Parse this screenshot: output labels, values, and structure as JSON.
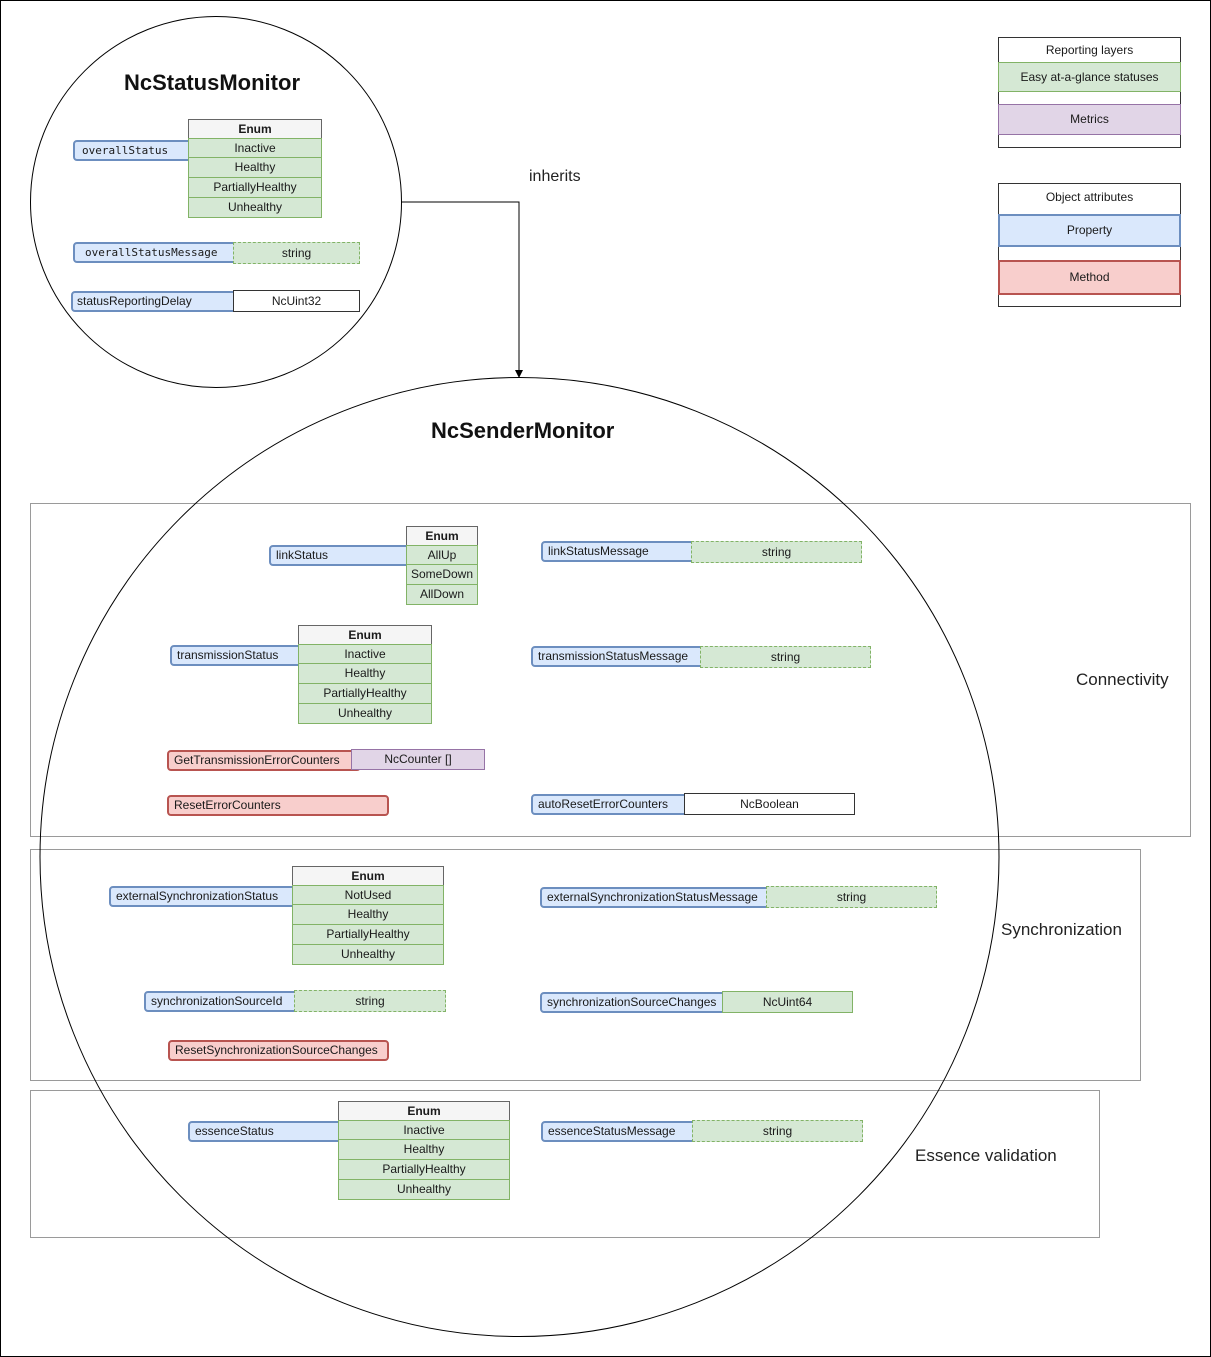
{
  "status_monitor": {
    "title": "NcStatusMonitor",
    "overall_status": {
      "name": "overallStatus",
      "enum_header": "Enum",
      "values": [
        "Inactive",
        "Healthy",
        "PartiallyHealthy",
        "Unhealthy"
      ]
    },
    "overall_status_message": {
      "name": "overallStatusMessage",
      "type": "string"
    },
    "status_reporting_delay": {
      "name": "statusReportingDelay",
      "type": "NcUint32"
    }
  },
  "inherits_label": "inherits",
  "sender_monitor": {
    "title": "NcSenderMonitor",
    "sections": {
      "connectivity": {
        "label": "Connectivity",
        "link_status": {
          "name": "linkStatus",
          "enum_header": "Enum",
          "values": [
            "AllUp",
            "SomeDown",
            "AllDown"
          ]
        },
        "link_status_message": {
          "name": "linkStatusMessage",
          "type": "string"
        },
        "transmission_status": {
          "name": "transmissionStatus",
          "enum_header": "Enum",
          "values": [
            "Inactive",
            "Healthy",
            "PartiallyHealthy",
            "Unhealthy"
          ]
        },
        "transmission_status_message": {
          "name": "transmissionStatusMessage",
          "type": "string"
        },
        "get_transmission_error_counters": {
          "name": "GetTransmissionErrorCounters",
          "type": "NcCounter []"
        },
        "reset_error_counters": {
          "name": "ResetErrorCounters"
        },
        "auto_reset_error_counters": {
          "name": "autoResetErrorCounters",
          "type": "NcBoolean"
        }
      },
      "synchronization": {
        "label": "Synchronization",
        "external_synchronization_status": {
          "name": "externalSynchronizationStatus",
          "enum_header": "Enum",
          "values": [
            "NotUsed",
            "Healthy",
            "PartiallyHealthy",
            "Unhealthy"
          ]
        },
        "external_synchronization_status_message": {
          "name": "externalSynchronizationStatusMessage",
          "type": "string"
        },
        "synchronization_source_id": {
          "name": "synchronizationSourceId",
          "type": "string"
        },
        "synchronization_source_changes": {
          "name": "synchronizationSourceChanges",
          "type": "NcUint64"
        },
        "reset_synchronization_source_changes": {
          "name": "ResetSynchronizationSourceChanges"
        }
      },
      "essence": {
        "label": "Essence validation",
        "essence_status": {
          "name": "essenceStatus",
          "enum_header": "Enum",
          "values": [
            "Inactive",
            "Healthy",
            "PartiallyHealthy",
            "Unhealthy"
          ]
        },
        "essence_status_message": {
          "name": "essenceStatusMessage",
          "type": "string"
        }
      }
    }
  },
  "legend": {
    "reporting_layers": {
      "title": "Reporting layers",
      "items": [
        "Easy at-a-glance statuses",
        "Metrics"
      ]
    },
    "object_attributes": {
      "title": "Object attributes",
      "items": [
        "Property",
        "Method"
      ]
    }
  },
  "colors": {
    "property_fill": "#dae8fc",
    "property_stroke": "#6c8ebf",
    "method_fill": "#f8cecc",
    "method_stroke": "#b85450",
    "status_fill": "#d5e8d4",
    "status_stroke": "#82b366",
    "metrics_fill": "#e1d5e7",
    "metrics_stroke": "#9673a6"
  }
}
